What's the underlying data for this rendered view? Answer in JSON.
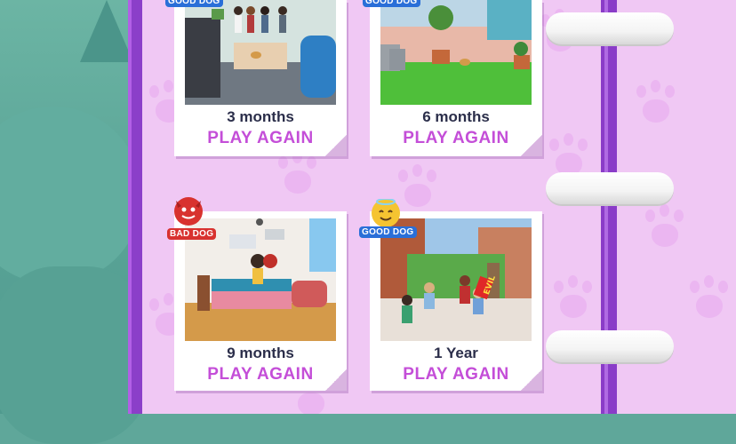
{
  "cards": [
    {
      "label": "3 months",
      "action": "PLAY AGAIN",
      "badge": "GOOD DOG"
    },
    {
      "label": "6 months",
      "action": "PLAY AGAIN",
      "badge": "GOOD DOG"
    },
    {
      "label": "9 months",
      "action": "PLAY AGAIN",
      "badge": "BAD DOG"
    },
    {
      "label": "1 Year",
      "action": "PLAY AGAIN",
      "badge": "GOOD DOG"
    }
  ],
  "scene_text": {
    "sign": "EVIL"
  },
  "colors": {
    "accent": "#c44ed8",
    "label": "#2b2e4a",
    "page": "#f0c8f4",
    "spine": "#8a3cc8",
    "good_badge": "#2a6fd8",
    "bad_badge": "#d8322f"
  }
}
